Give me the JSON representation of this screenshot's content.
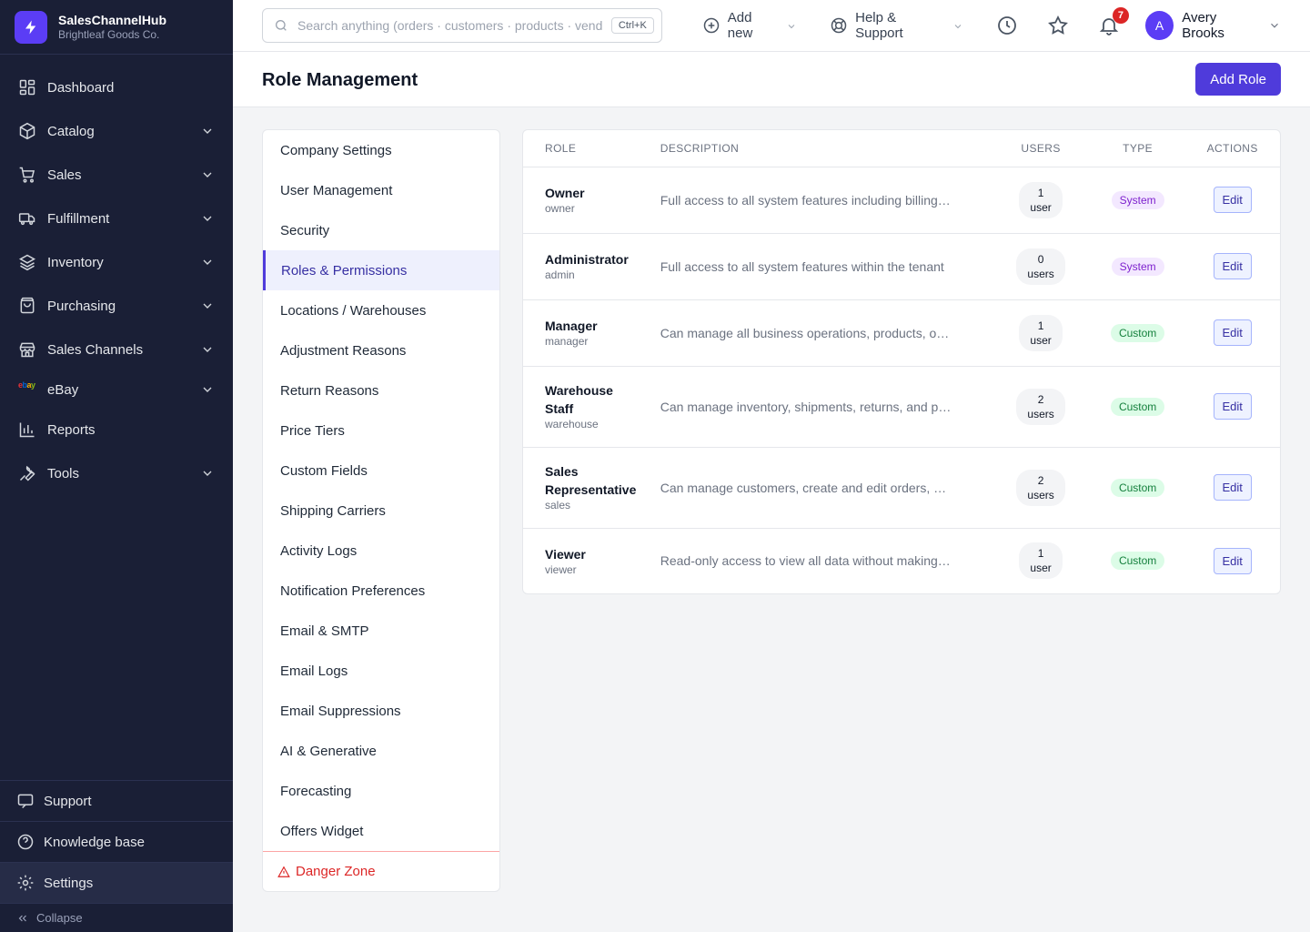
{
  "brand": {
    "name": "SalesChannelHub",
    "org": "Brightleaf Goods Co.",
    "accent": "#5b3df5",
    "logo_icon": "bolt-icon"
  },
  "sidebar": {
    "items": [
      {
        "label": "Dashboard",
        "icon": "dashboard-icon",
        "expandable": false
      },
      {
        "label": "Catalog",
        "icon": "box-icon",
        "expandable": true
      },
      {
        "label": "Sales",
        "icon": "cart-icon",
        "expandable": true
      },
      {
        "label": "Fulfillment",
        "icon": "truck-icon",
        "expandable": true
      },
      {
        "label": "Inventory",
        "icon": "layers-icon",
        "expandable": true
      },
      {
        "label": "Purchasing",
        "icon": "bag-icon",
        "expandable": true
      },
      {
        "label": "Sales Channels",
        "icon": "store-icon",
        "expandable": true
      },
      {
        "label": "eBay",
        "icon": "ebay-logo",
        "expandable": true
      },
      {
        "label": "Reports",
        "icon": "chart-icon",
        "expandable": false
      },
      {
        "label": "Tools",
        "icon": "wrench-icon",
        "expandable": true
      }
    ],
    "ebay_logo": {
      "e": "e",
      "b": "b",
      "a": "a",
      "y": "y"
    },
    "bottom": {
      "support": "Support",
      "knowledge_base": "Knowledge base",
      "settings": "Settings",
      "collapse": "Collapse"
    }
  },
  "topbar": {
    "search_placeholder": "Search anything (orders · customers · products · vendors)",
    "search_shortcut": "Ctrl+K",
    "add_new": "Add new",
    "help": "Help & Support",
    "notifications_count": "7",
    "user_initial": "A",
    "user_name": "Avery Brooks"
  },
  "page": {
    "title": "Role Management",
    "add_button": "Add Role"
  },
  "settings_menu": {
    "items": [
      "Company Settings",
      "User Management",
      "Security",
      "Roles & Permissions",
      "Locations / Warehouses",
      "Adjustment Reasons",
      "Return Reasons",
      "Price Tiers",
      "Custom Fields",
      "Shipping Carriers",
      "Activity Logs",
      "Notification Preferences",
      "Email & SMTP",
      "Email Logs",
      "Email Suppressions",
      "AI & Generative",
      "Forecasting",
      "Offers Widget"
    ],
    "active": "Roles & Permissions",
    "danger": "Danger Zone"
  },
  "roles_table": {
    "headers": {
      "role": "ROLE",
      "description": "DESCRIPTION",
      "users": "USERS",
      "type": "TYPE",
      "actions": "ACTIONS"
    },
    "edit_label": "Edit",
    "rows": [
      {
        "name_line1": "Owner",
        "name_line2": "",
        "key": "owner",
        "description": "Full access to all system features including billing and tenant management",
        "users_count": "1",
        "users_unit": "user",
        "type": "System"
      },
      {
        "name_line1": "Administrator",
        "name_line2": "",
        "key": "admin",
        "description": "Full access to all system features within the tenant",
        "users_count": "0",
        "users_unit": "users",
        "type": "System"
      },
      {
        "name_line1": "Manager",
        "name_line2": "",
        "key": "manager",
        "description": "Can manage all business operations, products, orders and customers",
        "users_count": "1",
        "users_unit": "user",
        "type": "Custom"
      },
      {
        "name_line1": "Warehouse",
        "name_line2": "Staff",
        "key": "warehouse",
        "description": "Can manage inventory, shipments, returns, and purchase orders",
        "users_count": "2",
        "users_unit": "users",
        "type": "Custom"
      },
      {
        "name_line1": "Sales",
        "name_line2": "Representative",
        "key": "sales",
        "description": "Can manage customers, create and edit orders, and view products",
        "users_count": "2",
        "users_unit": "users",
        "type": "Custom"
      },
      {
        "name_line1": "Viewer",
        "name_line2": "",
        "key": "viewer",
        "description": "Read-only access to view all data without making changes",
        "users_count": "1",
        "users_unit": "user",
        "type": "Custom"
      }
    ]
  },
  "colors": {
    "sidebar_bg": "#1a1f36",
    "primary": "#4f3bdb",
    "danger": "#dc2626",
    "system_badge": "#7e22ce",
    "custom_badge": "#15803d"
  }
}
